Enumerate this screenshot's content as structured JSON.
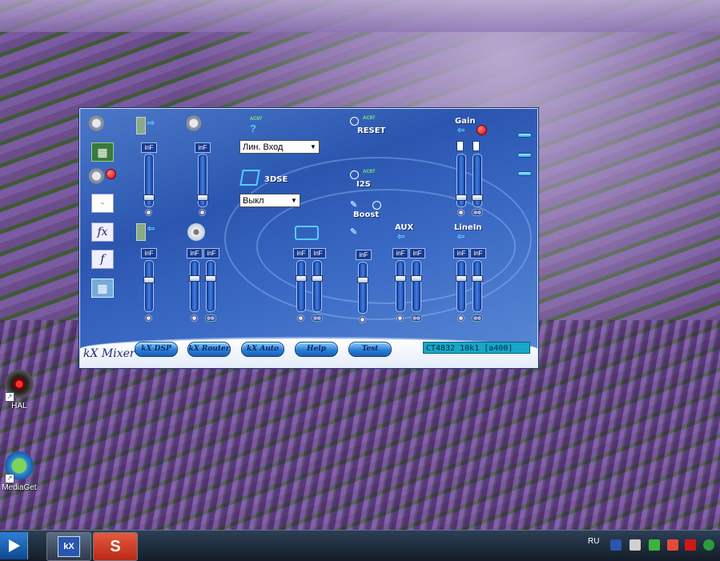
{
  "mixer": {
    "title": "kX Mixer",
    "slider_value": "inF",
    "gain_label": "Gain",
    "ac97_label": "AC97",
    "reset_label": "RESET",
    "i2s_label": "I2S",
    "boost_label": "Boost",
    "aux_label": "AUX",
    "linein_label": "LineIn",
    "se3d_label": "3DSE",
    "input_select": "Лин. Вход",
    "se3d_select": "Выкл",
    "buttons": {
      "dsp": "kX DSP",
      "router": "kX Router",
      "auto": "kX Auto",
      "help": "Help",
      "test": "Test"
    },
    "status": "CT4832 10k1 [a400]",
    "side_fx": "fx",
    "side_f": "f"
  },
  "desktop": {
    "icons": [
      {
        "label": "HAL",
        "icon": "hal-eye-icon"
      },
      {
        "label": "MediaGet",
        "icon": "mediaget-download-icon"
      }
    ]
  },
  "taskbar": {
    "language": "RU",
    "apps": [
      {
        "icon": "kx-mixer-app-icon",
        "label": "kX"
      },
      {
        "icon": "s-app-icon",
        "label": "S"
      }
    ]
  },
  "colors": {
    "mixer_blue": "#2b56b0",
    "status_cyan": "#17a7c8",
    "record_red": "#d00000",
    "ac97_green": "#74f07c"
  }
}
